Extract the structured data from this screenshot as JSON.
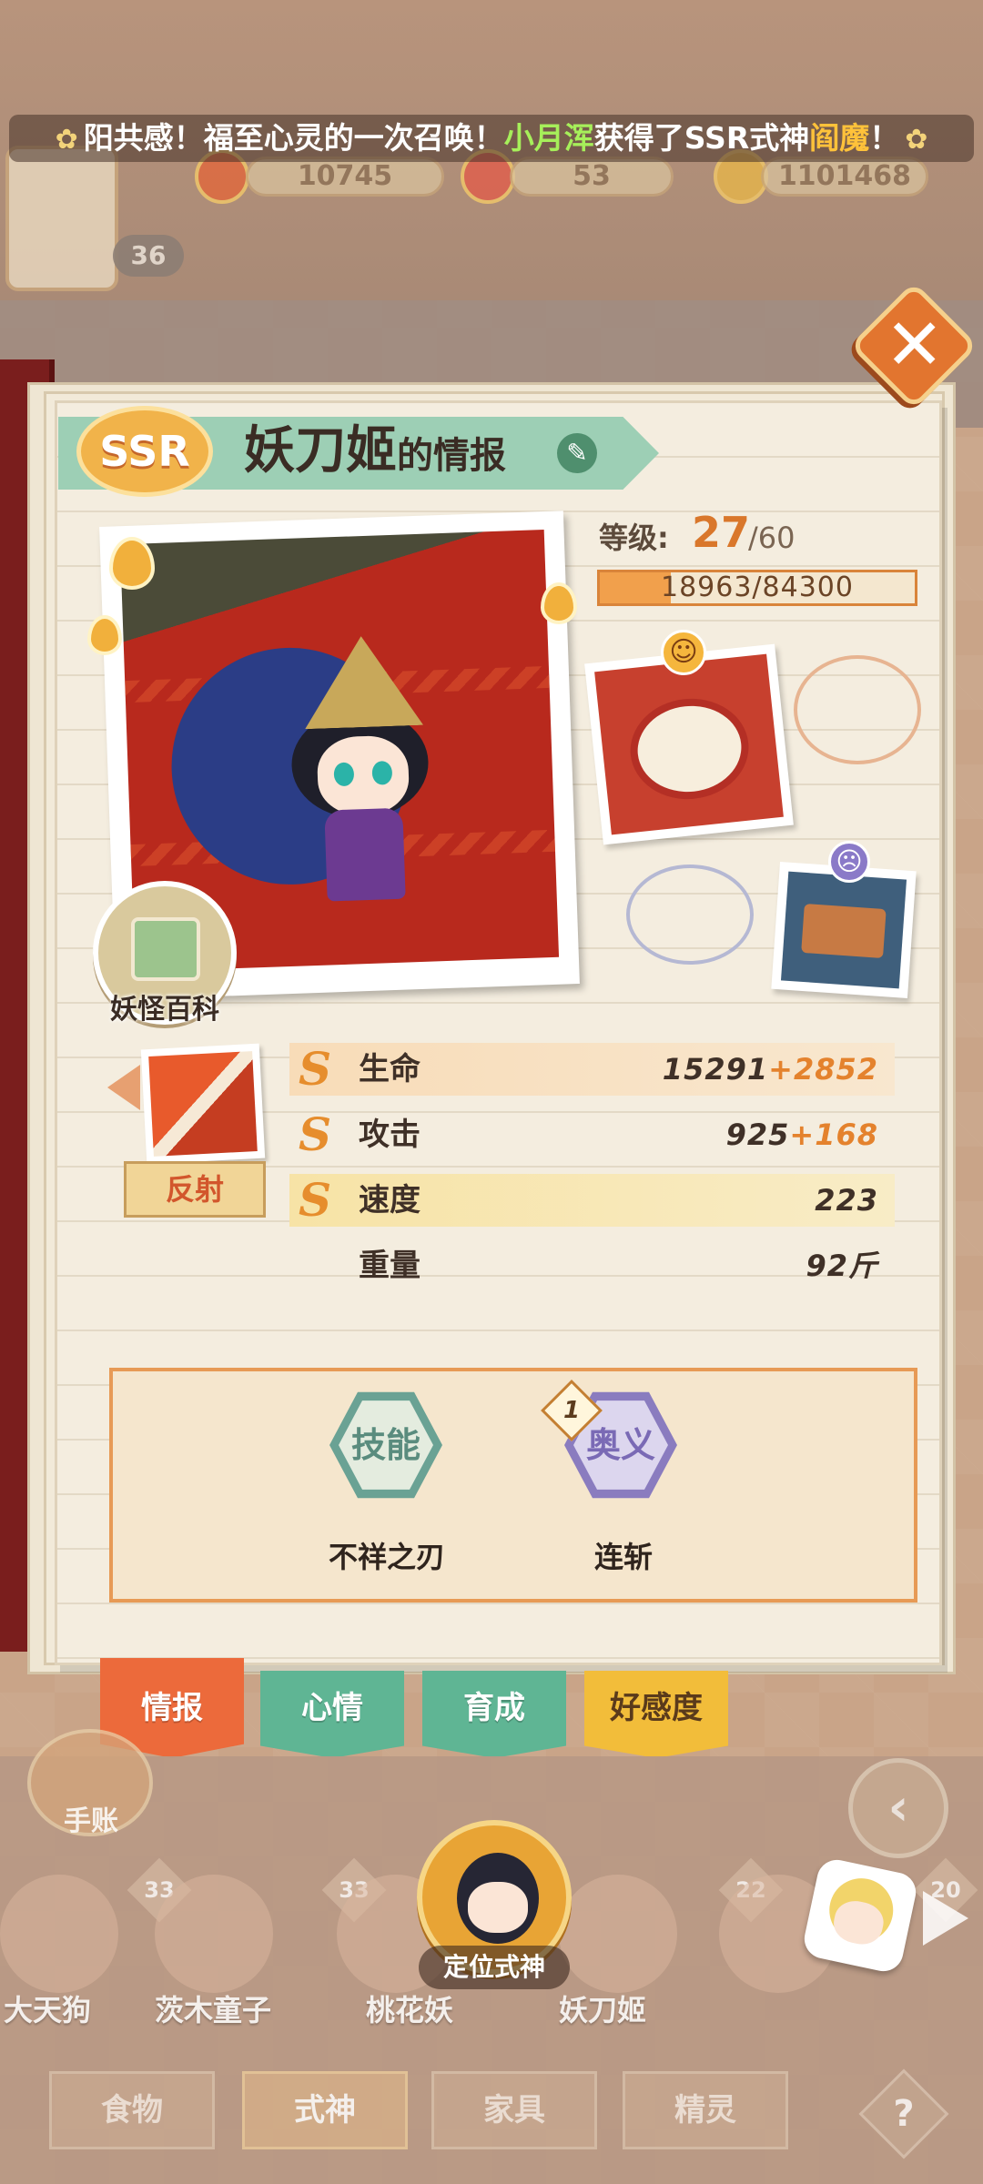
{
  "banner": {
    "prefix": "阳共感！福至心灵的一次召唤！",
    "player": "小月浑",
    "middle": "获得了SSR式神",
    "shikigami": "阎魔",
    "suffix": "！",
    "flower_left": "✿",
    "flower_right": "✿"
  },
  "resources": {
    "gold": "10745",
    "jade": "53",
    "coins": "1101468"
  },
  "player": {
    "level": "36"
  },
  "close_label": "✕",
  "card": {
    "rarity": "SSR",
    "name": "妖刀姬",
    "title_suffix": "的情报",
    "edit_icon": "✎",
    "encyclopedia": "妖怪百科",
    "level_label": "等级:",
    "level": "27",
    "level_max": "/60",
    "exp_text": "18963/84300",
    "exp_current": 18963,
    "exp_max": 84300,
    "like_emoji": "☺",
    "dislike_emoji": "☹",
    "type_label": "反射",
    "stats": [
      {
        "name": "生命",
        "base": "15291",
        "bonus": "+2852",
        "icon": "S"
      },
      {
        "name": "攻击",
        "base": "925",
        "bonus": "+168",
        "icon": "S"
      },
      {
        "name": "速度",
        "base": "223",
        "bonus": "",
        "icon": "S"
      },
      {
        "name": "重量",
        "base": "92斤",
        "bonus": "",
        "icon": ""
      }
    ],
    "skill": {
      "icon_text": "技能",
      "name": "不祥之刃"
    },
    "ougi": {
      "icon_text": "奥义",
      "name": "连斩",
      "badge": "1"
    }
  },
  "tabs": [
    "情报",
    "心情",
    "育成",
    "好感度"
  ],
  "bottom": {
    "notebook": "手账",
    "nav_prev_icon": "‹",
    "locate_label": "定位式神",
    "roster": [
      {
        "name": "大天狗",
        "level": ""
      },
      {
        "name": "茨木童子",
        "level": "33"
      },
      {
        "name": "桃花妖",
        "level": "33"
      },
      {
        "name": "妖刀姬",
        "level": ""
      },
      {
        "name": "",
        "level": "22"
      },
      {
        "name": "",
        "level": "20"
      }
    ],
    "categories": [
      "食物",
      "式神",
      "家具",
      "精灵"
    ],
    "help": "?"
  },
  "colors": {
    "accent_orange": "#e68d2d",
    "tab_active": "#ec6a3b",
    "tab_green": "#5fb594",
    "tab_yellow": "#f2bd3a",
    "highlight_green": "#a6ef5a"
  }
}
